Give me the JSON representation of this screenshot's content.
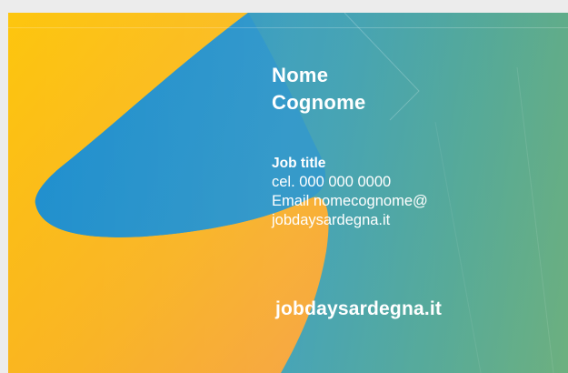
{
  "card": {
    "name_first": "Nome",
    "name_last": "Cognome",
    "job_title": "Job title",
    "phone": "cel. 000 000 0000",
    "email_line1": "Email nomecognome@",
    "email_line2": "jobdaysardegna.it",
    "website": "jobdaysardegna.it"
  },
  "colors": {
    "yellow": "#fcc11a",
    "orange": "#f7a234",
    "blue": "#1f8fc9",
    "green": "#6db07f",
    "text": "#ffffff"
  }
}
